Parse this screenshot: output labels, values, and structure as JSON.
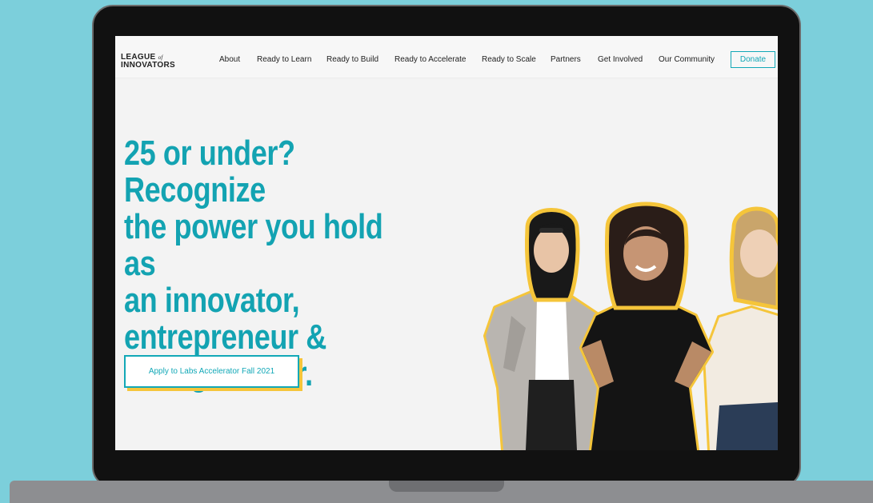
{
  "nav": {
    "logo_line1": "LEAGUE",
    "logo_of": "of",
    "logo_line2": "INNOVATORS",
    "items": [
      {
        "label": "About"
      },
      {
        "label": "Ready to Learn"
      },
      {
        "label": "Ready to Build"
      },
      {
        "label": "Ready to Accelerate"
      },
      {
        "label": "Ready to Scale"
      },
      {
        "label": "Partners"
      },
      {
        "label": "Get Involved"
      },
      {
        "label": "Our Community"
      }
    ],
    "donate_label": "Donate"
  },
  "hero": {
    "headline_lines": [
      "25 or under? Recognize",
      "the power you hold as",
      "an innovator,",
      "entrepreneur &",
      "changemaker."
    ],
    "cta_label": "Apply to Labs Accelerator Fall 2021"
  },
  "colors": {
    "brand_teal": "#13a3b2",
    "accent_yellow": "#f5c53a",
    "backdrop": "#7ccfdb"
  }
}
